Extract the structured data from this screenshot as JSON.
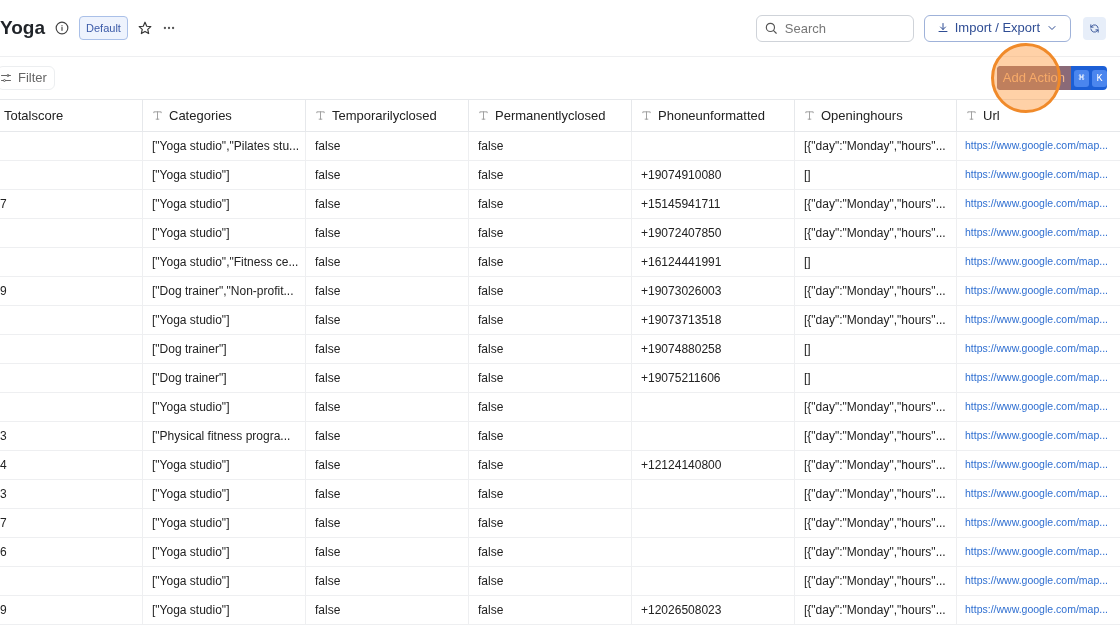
{
  "header": {
    "title": "Yoga",
    "badge": "Default",
    "search": {
      "placeholder": "Search"
    },
    "import_export": "Import / Export"
  },
  "toolbar": {
    "filter": "Filter",
    "add_action": "Add Action",
    "shortcut_keys": [
      "⌘",
      "K"
    ],
    "click_highlight": true
  },
  "table": {
    "columns": [
      {
        "label": "Totalscore",
        "typed": false
      },
      {
        "label": "Categories",
        "typed": true
      },
      {
        "label": "Temporarilyclosed",
        "typed": true
      },
      {
        "label": "Permanentlyclosed",
        "typed": true
      },
      {
        "label": "Phoneunformatted",
        "typed": true
      },
      {
        "label": "Openinghours",
        "typed": true
      },
      {
        "label": "Url",
        "typed": true
      }
    ],
    "rows": [
      [
        "",
        "[\"Yoga studio\",\"Pilates stu...",
        "false",
        "false",
        "",
        "[{\"day\":\"Monday\",\"hours\"...",
        "https://www.google.com/map..."
      ],
      [
        "",
        "[\"Yoga studio\"]",
        "false",
        "false",
        "+19074910080",
        "[]",
        "https://www.google.com/map..."
      ],
      [
        "7",
        "[\"Yoga studio\"]",
        "false",
        "false",
        "+15145941711",
        "[{\"day\":\"Monday\",\"hours\"...",
        "https://www.google.com/map..."
      ],
      [
        "",
        "[\"Yoga studio\"]",
        "false",
        "false",
        "+19072407850",
        "[{\"day\":\"Monday\",\"hours\"...",
        "https://www.google.com/map..."
      ],
      [
        "",
        "[\"Yoga studio\",\"Fitness ce...",
        "false",
        "false",
        "+16124441991",
        "[]",
        "https://www.google.com/map..."
      ],
      [
        "9",
        "[\"Dog trainer\",\"Non-profit...",
        "false",
        "false",
        "+19073026003",
        "[{\"day\":\"Monday\",\"hours\"...",
        "https://www.google.com/map..."
      ],
      [
        "",
        "[\"Yoga studio\"]",
        "false",
        "false",
        "+19073713518",
        "[{\"day\":\"Monday\",\"hours\"...",
        "https://www.google.com/map..."
      ],
      [
        "",
        "[\"Dog trainer\"]",
        "false",
        "false",
        "+19074880258",
        "[]",
        "https://www.google.com/map..."
      ],
      [
        "",
        "[\"Dog trainer\"]",
        "false",
        "false",
        "+19075211606",
        "[]",
        "https://www.google.com/map..."
      ],
      [
        "",
        "[\"Yoga studio\"]",
        "false",
        "false",
        "",
        "[{\"day\":\"Monday\",\"hours\"...",
        "https://www.google.com/map..."
      ],
      [
        "3",
        "[\"Physical fitness progra...",
        "false",
        "false",
        "",
        "[{\"day\":\"Monday\",\"hours\"...",
        "https://www.google.com/map..."
      ],
      [
        "4",
        "[\"Yoga studio\"]",
        "false",
        "false",
        "+12124140800",
        "[{\"day\":\"Monday\",\"hours\"...",
        "https://www.google.com/map..."
      ],
      [
        "3",
        "[\"Yoga studio\"]",
        "false",
        "false",
        "",
        "[{\"day\":\"Monday\",\"hours\"...",
        "https://www.google.com/map..."
      ],
      [
        "7",
        "[\"Yoga studio\"]",
        "false",
        "false",
        "",
        "[{\"day\":\"Monday\",\"hours\"...",
        "https://www.google.com/map..."
      ],
      [
        "6",
        "[\"Yoga studio\"]",
        "false",
        "false",
        "",
        "[{\"day\":\"Monday\",\"hours\"...",
        "https://www.google.com/map..."
      ],
      [
        "",
        "[\"Yoga studio\"]",
        "false",
        "false",
        "",
        "[{\"day\":\"Monday\",\"hours\"...",
        "https://www.google.com/map..."
      ],
      [
        "9",
        "[\"Yoga studio\"]",
        "false",
        "false",
        "+12026508023",
        "[{\"day\":\"Monday\",\"hours\"...",
        "https://www.google.com/map..."
      ]
    ]
  }
}
